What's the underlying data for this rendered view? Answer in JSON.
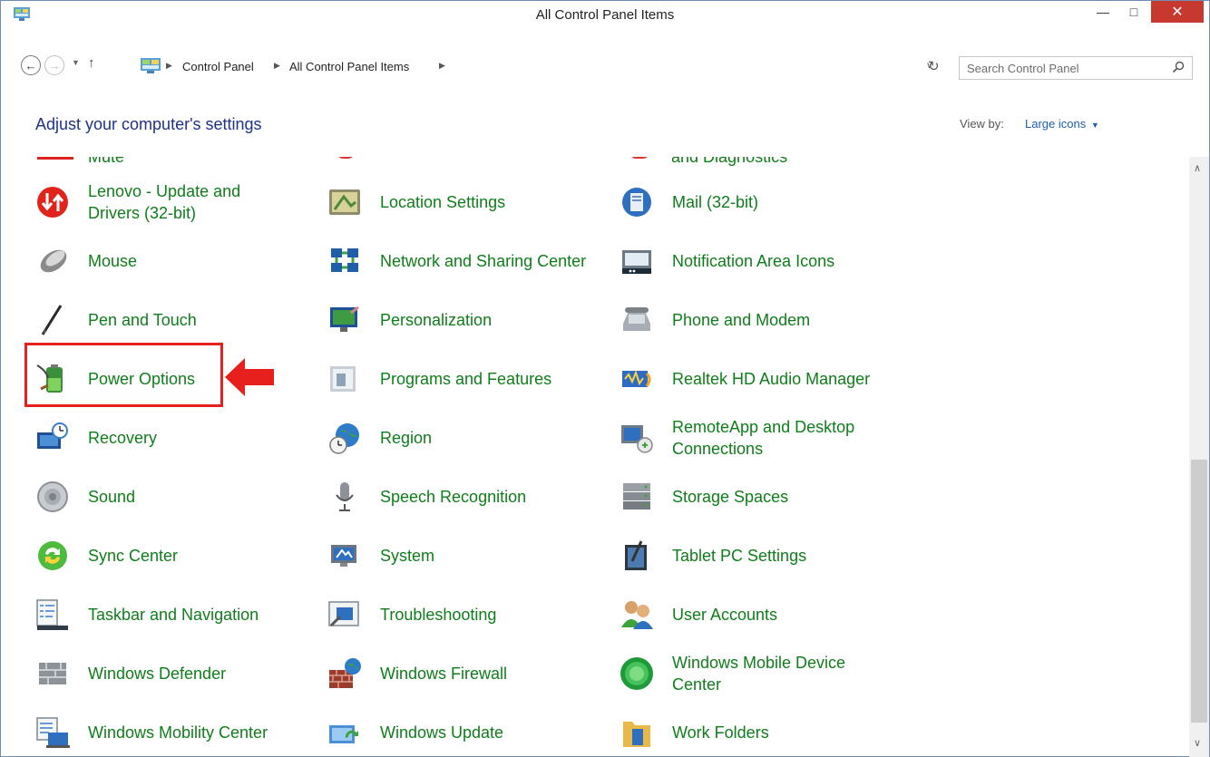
{
  "window": {
    "title": "All Control Panel Items"
  },
  "address": {
    "crumbs": [
      "Control Panel",
      "All Control Panel Items"
    ]
  },
  "search": {
    "placeholder": "Search Control Panel"
  },
  "header": {
    "title": "Adjust your computer's settings",
    "view_by_label": "View by:",
    "view_by_value": "Large icons"
  },
  "partial_items": [
    "Mute",
    "and Diagnostics"
  ],
  "items": [
    {
      "label": "Lenovo - Update and Drivers (32-bit)",
      "icon": "lenovo-update-icon"
    },
    {
      "label": "Location Settings",
      "icon": "location-icon"
    },
    {
      "label": "Mail (32-bit)",
      "icon": "mail-icon"
    },
    {
      "label": "Mouse",
      "icon": "mouse-icon"
    },
    {
      "label": "Network and Sharing Center",
      "icon": "network-icon"
    },
    {
      "label": "Notification Area Icons",
      "icon": "notification-icon"
    },
    {
      "label": "Pen and Touch",
      "icon": "pen-icon"
    },
    {
      "label": "Personalization",
      "icon": "personalization-icon"
    },
    {
      "label": "Phone and Modem",
      "icon": "phone-icon"
    },
    {
      "label": "Power Options",
      "icon": "battery-icon"
    },
    {
      "label": "Programs and Features",
      "icon": "programs-icon"
    },
    {
      "label": "Realtek HD Audio Manager",
      "icon": "audio-manager-icon"
    },
    {
      "label": "Recovery",
      "icon": "recovery-icon"
    },
    {
      "label": "Region",
      "icon": "globe-clock-icon"
    },
    {
      "label": "RemoteApp and Desktop Connections",
      "icon": "remote-icon"
    },
    {
      "label": "Sound",
      "icon": "speaker-icon"
    },
    {
      "label": "Speech Recognition",
      "icon": "microphone-icon"
    },
    {
      "label": "Storage Spaces",
      "icon": "storage-icon"
    },
    {
      "label": "Sync Center",
      "icon": "sync-icon"
    },
    {
      "label": "System",
      "icon": "system-icon"
    },
    {
      "label": "Tablet PC Settings",
      "icon": "tablet-icon"
    },
    {
      "label": "Taskbar and Navigation",
      "icon": "taskbar-icon"
    },
    {
      "label": "Troubleshooting",
      "icon": "troubleshoot-icon"
    },
    {
      "label": "User Accounts",
      "icon": "users-icon"
    },
    {
      "label": "Windows Defender",
      "icon": "defender-icon"
    },
    {
      "label": "Windows Firewall",
      "icon": "firewall-icon"
    },
    {
      "label": "Windows Mobile Device Center",
      "icon": "mobile-device-icon"
    },
    {
      "label": "Windows Mobility Center",
      "icon": "mobility-icon"
    },
    {
      "label": "Windows Update",
      "icon": "update-icon"
    },
    {
      "label": "Work Folders",
      "icon": "folder-icon"
    }
  ],
  "colors": {
    "link_green": "#0f7d1a",
    "heading_blue": "#1e3287",
    "highlight_red": "#e8201d",
    "close_red": "#c7392f"
  }
}
